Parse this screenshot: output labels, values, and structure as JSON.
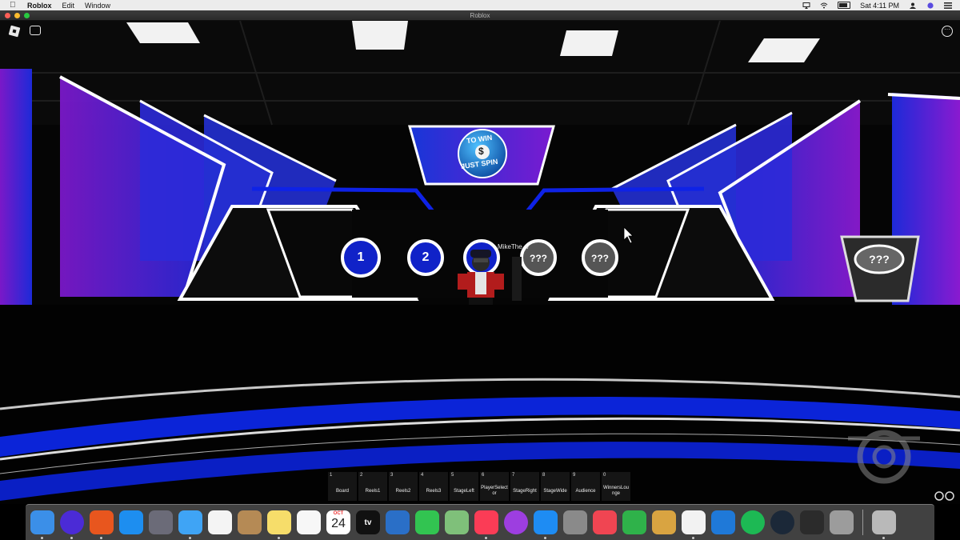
{
  "menubar": {
    "apple_icon": "apple-icon",
    "app_name": "Roblox",
    "menus": [
      "Edit",
      "Window"
    ],
    "clock": "Sat 4:11 PM"
  },
  "window": {
    "title": "Roblox"
  },
  "game": {
    "sign_text_top": "TO WIN",
    "sign_text_bottom": "JUST SPIN",
    "sign_symbol": "$",
    "player_name": "MikeThe_v",
    "wheels": [
      "1",
      "2",
      "",
      "???",
      "???"
    ],
    "side_screen": "???"
  },
  "hotbar": [
    {
      "num": "1",
      "label": "Board"
    },
    {
      "num": "2",
      "label": "Reels1"
    },
    {
      "num": "3",
      "label": "Reels2"
    },
    {
      "num": "4",
      "label": "Reels3"
    },
    {
      "num": "5",
      "label": "StageLeft"
    },
    {
      "num": "6",
      "label": "PlayerSelector"
    },
    {
      "num": "7",
      "label": "StageRight"
    },
    {
      "num": "8",
      "label": "StageWide"
    },
    {
      "num": "9",
      "label": "Audience"
    },
    {
      "num": "0",
      "label": "WinnersLounge"
    }
  ],
  "dock": [
    {
      "name": "finder",
      "color": "#3b8fe8"
    },
    {
      "name": "siri",
      "color": "#4b2bd6"
    },
    {
      "name": "firefox",
      "color": "#e8561e"
    },
    {
      "name": "safari",
      "color": "#1d8ef0"
    },
    {
      "name": "launchpad",
      "color": "#6b6b78"
    },
    {
      "name": "messages",
      "color": "#3fa4f5"
    },
    {
      "name": "photos",
      "color": "#f4f4f4"
    },
    {
      "name": "contacts",
      "color": "#b58a55"
    },
    {
      "name": "notes",
      "color": "#f6dd6a"
    },
    {
      "name": "reminders",
      "color": "#f7f7f7"
    },
    {
      "name": "calendar",
      "color": "#ffffff",
      "month": "OCT",
      "day": "24"
    },
    {
      "name": "apple-tv",
      "color": "#111111",
      "label": "tv"
    },
    {
      "name": "quicktime",
      "color": "#2a6fc7"
    },
    {
      "name": "facetime",
      "color": "#32c451"
    },
    {
      "name": "maps",
      "color": "#7fc07a"
    },
    {
      "name": "music",
      "color": "#fb3c56"
    },
    {
      "name": "podcasts",
      "color": "#9d3ee0"
    },
    {
      "name": "app-store",
      "color": "#1e8cf3"
    },
    {
      "name": "system-preferences",
      "color": "#8a8a8a"
    },
    {
      "name": "news",
      "color": "#f04552"
    },
    {
      "name": "numbers",
      "color": "#2fb24a"
    },
    {
      "name": "preview",
      "color": "#d9a441"
    },
    {
      "name": "roblox",
      "color": "#f2f2f2"
    },
    {
      "name": "roblox-studio",
      "color": "#1f79d8"
    },
    {
      "name": "spotify",
      "color": "#1db954"
    },
    {
      "name": "steam",
      "color": "#1b2838"
    },
    {
      "name": "davinci-resolve",
      "color": "#2b2b2b"
    },
    {
      "name": "calculator",
      "color": "#9c9c9c"
    },
    {
      "name": "trash",
      "color": "#b9b9b9"
    }
  ]
}
